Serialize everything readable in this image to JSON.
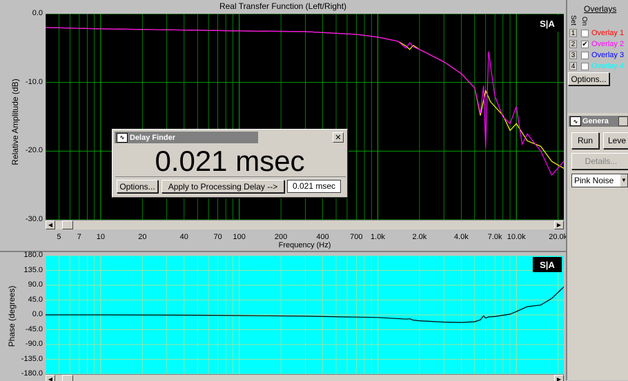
{
  "magnitude": {
    "title": "Real Transfer Function (Left/Right)",
    "ylabel": "Relative Amplitude (dB)",
    "xlabel": "Frequency (Hz)",
    "yticks": [
      "0.0",
      "-10.0",
      "-20.0",
      "-30.0"
    ],
    "xticks": [
      "5",
      "7",
      "10",
      "20",
      "40",
      "70",
      "100",
      "200",
      "400",
      "700",
      "1.0k",
      "2.0k",
      "4.0k",
      "7.0k",
      "10.0k",
      "20.0k"
    ],
    "logo": "S|A",
    "colors": {
      "background": "#000000",
      "grid": "#00a000"
    }
  },
  "phase": {
    "ylabel": "Phase (degrees)",
    "yticks": [
      "180.0",
      "135.0",
      "90.0",
      "45.0",
      "0.0",
      "-45.0",
      "-90.0",
      "-135.0",
      "-180.0"
    ],
    "logo": "S|A",
    "colors": {
      "background": "#00ffff",
      "grid": "#a0e0a0"
    }
  },
  "overlays": {
    "title": "Overlays",
    "set_label": "Set",
    "show_label": "On",
    "items": [
      {
        "num": "1",
        "label": "Overlay 1",
        "checked": false,
        "color": "#ff0000"
      },
      {
        "num": "2",
        "label": "Overlay 2",
        "checked": true,
        "color": "#ff00ff"
      },
      {
        "num": "3",
        "label": "Overlay 3",
        "checked": false,
        "color": "#0000ff"
      },
      {
        "num": "4",
        "label": "Overlay 4",
        "checked": false,
        "color": "#00ffff"
      }
    ],
    "options_label": "Options..."
  },
  "generator": {
    "title": "Genera",
    "run_label": "Run",
    "level_label": "Leve",
    "details_label": "Details...",
    "signal_value": "Pink Noise"
  },
  "delay_finder": {
    "title": "Delay Finder",
    "value": "0.021 msec",
    "options_label": "Options...",
    "apply_label": "Apply to Processing Delay -->",
    "delay_field": "0.021 msec",
    "close_label": "✕"
  },
  "chart_data": [
    {
      "type": "line",
      "title": "Real Transfer Function (Left/Right)",
      "xlabel": "Frequency (Hz)",
      "ylabel": "Relative Amplitude (dB)",
      "xscale": "log",
      "xlim": [
        4,
        22000
      ],
      "ylim": [
        -30,
        0
      ],
      "grid": true,
      "series": [
        {
          "color": "#ffff00",
          "x": [
            4,
            10,
            50,
            100,
            300,
            700,
            1000,
            1400,
            1600,
            1700,
            1800,
            2000,
            3000,
            4000,
            5000,
            5500,
            6000,
            6500,
            7000,
            8000,
            9000,
            10000,
            12000,
            15000,
            18000,
            22000
          ],
          "y": [
            -2.0,
            -2.2,
            -2.4,
            -2.5,
            -2.6,
            -3.0,
            -3.4,
            -4.0,
            -4.7,
            -5.2,
            -4.6,
            -5.2,
            -7.0,
            -8.7,
            -10.8,
            -14.8,
            -11.2,
            -12.8,
            -13.5,
            -14.8,
            -17.0,
            -16.0,
            -18.5,
            -19.3,
            -21.5,
            -22.5
          ]
        },
        {
          "color": "#ff00ff",
          "x": [
            4,
            10,
            50,
            100,
            300,
            700,
            1000,
            1400,
            1600,
            1700,
            1800,
            2000,
            3000,
            4000,
            5000,
            5500,
            5800,
            6000,
            6300,
            7000,
            8000,
            9000,
            10000,
            11000,
            12000,
            15000,
            18000,
            22000
          ],
          "y": [
            -2.0,
            -2.2,
            -2.4,
            -2.5,
            -2.6,
            -3.0,
            -3.4,
            -4.0,
            -5.0,
            -4.2,
            -4.8,
            -5.2,
            -7.0,
            -8.7,
            -10.8,
            -14.5,
            -10.5,
            -19.5,
            -5.5,
            -12.0,
            -15.0,
            -16.0,
            -13.5,
            -19.0,
            -17.5,
            -20.0,
            -23.5,
            -21.5
          ]
        }
      ]
    },
    {
      "type": "line",
      "xlabel": "Frequency (Hz)",
      "ylabel": "Phase (degrees)",
      "xscale": "log",
      "xlim": [
        4,
        22000
      ],
      "ylim": [
        -180,
        180
      ],
      "grid": true,
      "series": [
        {
          "color": "#000000",
          "x": [
            4,
            10,
            50,
            100,
            300,
            1000,
            1600,
            1700,
            1800,
            2000,
            3000,
            4000,
            5000,
            5500,
            5800,
            6000,
            6300,
            7000,
            9000,
            10000,
            12000,
            15000,
            18000,
            22000
          ],
          "y": [
            0,
            0,
            -1,
            -2,
            -4,
            -8,
            -13,
            -12,
            -16,
            -18,
            -22,
            -23,
            -21,
            -15,
            -3,
            -10,
            -6,
            -5,
            2,
            10,
            25,
            30,
            50,
            85
          ]
        }
      ]
    }
  ]
}
